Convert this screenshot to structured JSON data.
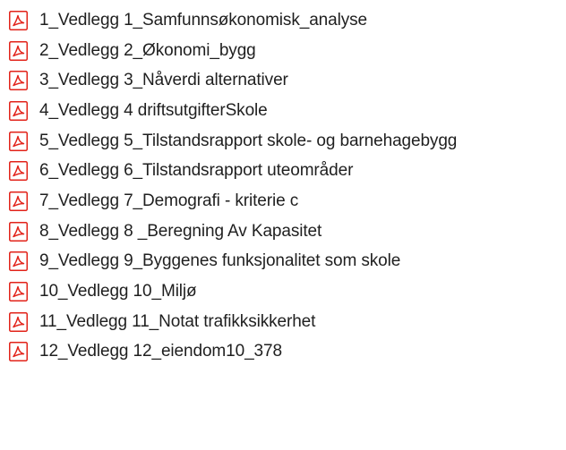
{
  "files": [
    {
      "name": "1_Vedlegg 1_Samfunnsøkonomisk_analyse",
      "icon": "pdf-icon"
    },
    {
      "name": "2_Vedlegg 2_Økonomi_bygg",
      "icon": "pdf-icon"
    },
    {
      "name": "3_Vedlegg 3_Nåverdi alternativer",
      "icon": "pdf-icon"
    },
    {
      "name": "4_Vedlegg 4 driftsutgifterSkole",
      "icon": "pdf-icon"
    },
    {
      "name": "5_Vedlegg 5_Tilstandsrapport skole- og barnehagebygg",
      "icon": "pdf-icon"
    },
    {
      "name": "6_Vedlegg 6_Tilstandsrapport uteområder",
      "icon": "pdf-icon"
    },
    {
      "name": "7_Vedlegg 7_Demografi - kriterie c",
      "icon": "pdf-icon"
    },
    {
      "name": "8_Vedlegg 8 _Beregning Av Kapasitet",
      "icon": "pdf-icon"
    },
    {
      "name": "9_Vedlegg 9_Byggenes funksjonalitet som skole",
      "icon": "pdf-icon"
    },
    {
      "name": "10_Vedlegg 10_Miljø",
      "icon": "pdf-icon"
    },
    {
      "name": "11_Vedlegg 11_Notat trafikksikkerhet",
      "icon": "pdf-icon"
    },
    {
      "name": "12_Vedlegg 12_eiendom10_378",
      "icon": "pdf-icon"
    }
  ],
  "colors": {
    "icon_red": "#e2231a",
    "text": "#1f1f1f",
    "background": "#ffffff"
  }
}
